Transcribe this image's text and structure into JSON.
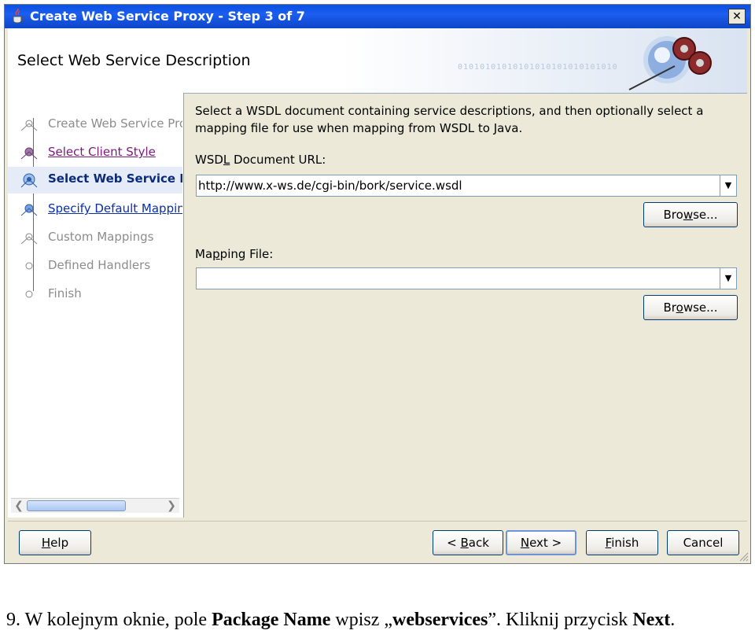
{
  "window": {
    "title": "Create Web Service Proxy - Step 3 of 7",
    "close": "✕"
  },
  "header": {
    "title": "Select Web Service Description",
    "binary": "01010101010101010101010101010"
  },
  "steps": [
    {
      "label": "Create Web Service Pro",
      "state": "disabled"
    },
    {
      "label": "Select Client Style",
      "state": "visited"
    },
    {
      "label": "Select Web Service D",
      "state": "current"
    },
    {
      "label": "Specify Default Mapping",
      "state": "link"
    },
    {
      "label": "Custom Mappings",
      "state": "disabled"
    },
    {
      "label": "Defined Handlers",
      "state": "disabled"
    },
    {
      "label": "Finish",
      "state": "disabled"
    }
  ],
  "scroll": {
    "left": "❮",
    "right": "❯"
  },
  "content": {
    "intro": "Select a WSDL document containing service descriptions, and then optionally select a mapping file for use when mapping from WSDL to Java.",
    "wsdl_label_a": "WSD",
    "wsdl_label_u": "L",
    "wsdl_label_b": " Document URL:",
    "wsdl_url": "http://www.x-ws.de/cgi-bin/bork/service.wsdl",
    "browse1_a": "Bro",
    "browse1_u": "w",
    "browse1_b": "se...",
    "mapping_label_a": "Ma",
    "mapping_label_u": "p",
    "mapping_label_b": "ping File:",
    "mapping_value": "",
    "browse2_a": "Br",
    "browse2_u": "o",
    "browse2_b": "wse...",
    "dropdown": "▼"
  },
  "buttons": {
    "help_u": "H",
    "help_b": "elp",
    "back_a": "< ",
    "back_u": "B",
    "back_b": "ack",
    "next_u": "N",
    "next_b": "ext >",
    "finish_u": "F",
    "finish_b": "inish",
    "cancel": "Cancel"
  },
  "caption": {
    "num": "9.  W kolejnym oknie, pole ",
    "bold1": "Package Name",
    "mid": " wpisz „",
    "bold2": "webservices",
    "mid2": "”. Kliknij przycisk ",
    "bold3": "Next",
    "end": "."
  }
}
